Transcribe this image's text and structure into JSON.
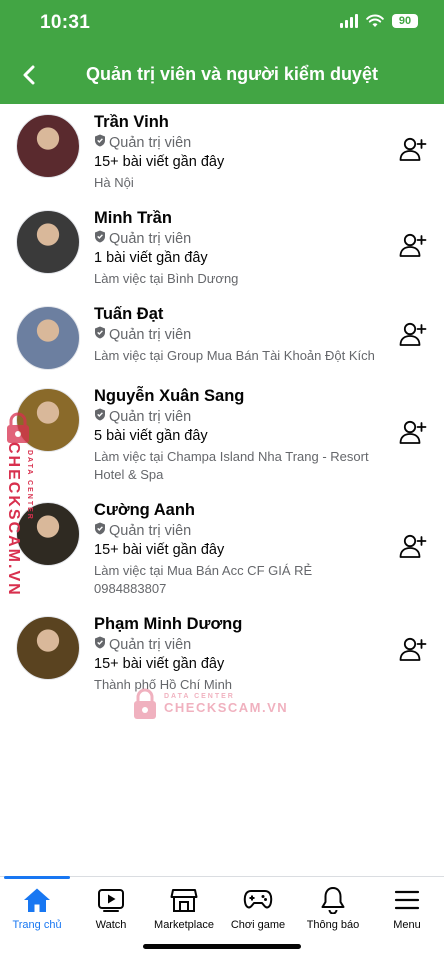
{
  "status_bar": {
    "time": "10:31",
    "battery": "90"
  },
  "header": {
    "title": "Quản trị viên và người kiểm duyệt"
  },
  "colors": {
    "header_bg": "#42a544",
    "accent": "#1877f2",
    "secondary_text": "#65676b"
  },
  "members": [
    {
      "name": "Trần Vinh",
      "role": "Quản trị viên",
      "posts": "15+ bài viết gần đây",
      "detail": "Hà Nội",
      "avatar_color": "#5a2a2e"
    },
    {
      "name": "Minh Trần",
      "role": "Quản trị viên",
      "posts": "1 bài viết gần đây",
      "detail": "Làm việc tại Bình Dương",
      "avatar_color": "#3a3a3a"
    },
    {
      "name": "Tuấn Đạt",
      "role": "Quản trị viên",
      "posts": "",
      "detail": "Làm việc tại Group Mua Bán Tài Khoản Đột Kích",
      "avatar_color": "#6c7fa0"
    },
    {
      "name": "Nguyễn Xuân Sang",
      "role": "Quản trị viên",
      "posts": "5 bài viết gần đây",
      "detail": "Làm việc tại Champa Island Nha Trang - Resort Hotel & Spa",
      "avatar_color": "#8a6a2a"
    },
    {
      "name": "Cường Aanh",
      "role": "Quản trị viên",
      "posts": "15+ bài viết gần đây",
      "detail": "Làm việc tại Mua Bán Acc CF GIÁ RẺ 0984883807",
      "avatar_color": "#2f2a22"
    },
    {
      "name": "Phạm Minh Dương",
      "role": "Quản trị viên",
      "posts": "15+ bài viết gần đây",
      "detail": "Thành phố Hồ Chí Minh",
      "avatar_color": "#5a4320"
    }
  ],
  "watermark": {
    "small": "DATA CENTER",
    "big": "CHECKSCAM.VN"
  },
  "tabs": [
    {
      "label": "Trang chủ",
      "icon": "home-icon"
    },
    {
      "label": "Watch",
      "icon": "watch-icon"
    },
    {
      "label": "Marketplace",
      "icon": "marketplace-icon"
    },
    {
      "label": "Chơi game",
      "icon": "gaming-icon"
    },
    {
      "label": "Thông báo",
      "icon": "bell-icon"
    },
    {
      "label": "Menu",
      "icon": "menu-icon"
    }
  ]
}
